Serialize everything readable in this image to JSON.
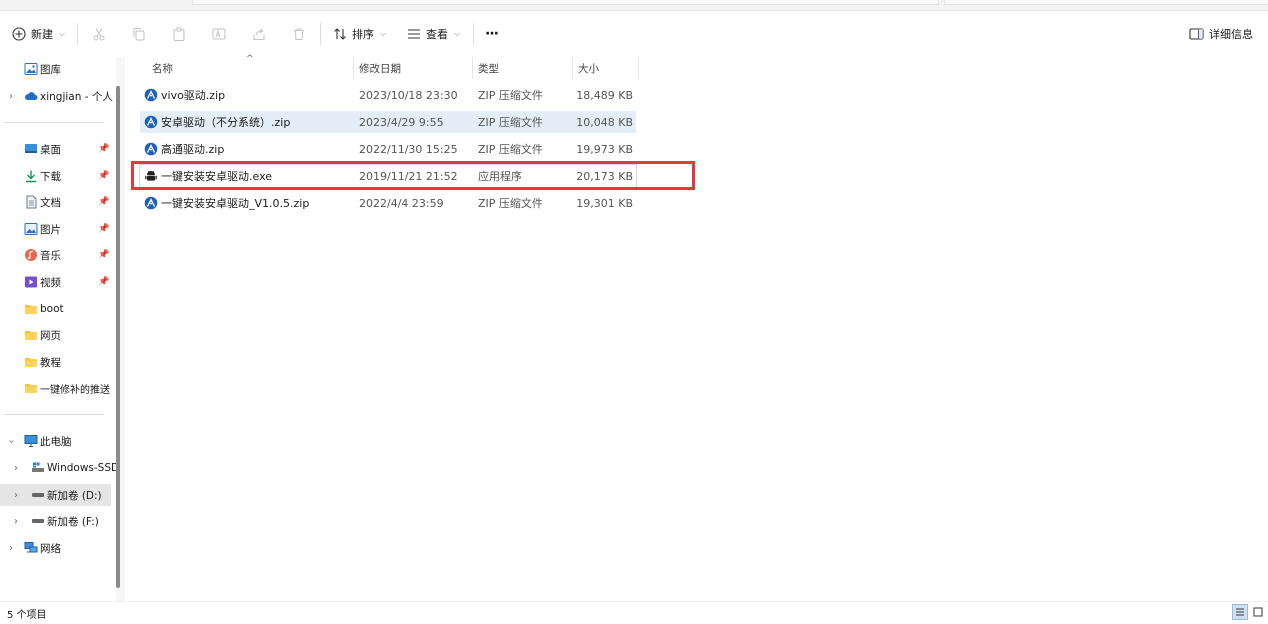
{
  "toolbar": {
    "new_label": "新建",
    "sort_label": "排序",
    "view_label": "查看",
    "more_label": "···",
    "details_label": "详细信息"
  },
  "nav": {
    "gallery": "图库",
    "onedrive": "xingjian - 个人",
    "quick": [
      {
        "label": "桌面"
      },
      {
        "label": "下载"
      },
      {
        "label": "文档"
      },
      {
        "label": "图片"
      },
      {
        "label": "音乐"
      },
      {
        "label": "视频"
      }
    ],
    "folders": [
      "boot",
      "网页",
      "教程",
      "一键修补的推送"
    ],
    "thispc": "此电脑",
    "drives": [
      "Windows-SSD",
      "新加卷 (D:)",
      "新加卷 (F:)"
    ],
    "network": "网络"
  },
  "columns": {
    "name": "名称",
    "date": "修改日期",
    "type": "类型",
    "size": "大小"
  },
  "files": [
    {
      "name": "vivo驱动.zip",
      "date": "2023/10/18 23:30",
      "type": "ZIP 压缩文件",
      "size": "18,489 KB",
      "icon": "zip"
    },
    {
      "name": "安卓驱动（不分系统）.zip",
      "date": "2023/4/29 9:55",
      "type": "ZIP 压缩文件",
      "size": "10,048 KB",
      "icon": "zip"
    },
    {
      "name": "高通驱动.zip",
      "date": "2022/11/30 15:25",
      "type": "ZIP 压缩文件",
      "size": "19,973 KB",
      "icon": "zip"
    },
    {
      "name": "一键安装安卓驱动.exe",
      "date": "2019/11/21 21:52",
      "type": "应用程序",
      "size": "20,173 KB",
      "icon": "exe"
    },
    {
      "name": "一键安装安卓驱动_V1.0.5.zip",
      "date": "2022/4/4 23:59",
      "type": "ZIP 压缩文件",
      "size": "19,301 KB",
      "icon": "zip"
    }
  ],
  "status": {
    "count": "5 个项目"
  },
  "colors": {
    "highlight_box": "#e8373c",
    "row_hover": "#e4eef8",
    "selected_nav": "#e5e5e5"
  }
}
